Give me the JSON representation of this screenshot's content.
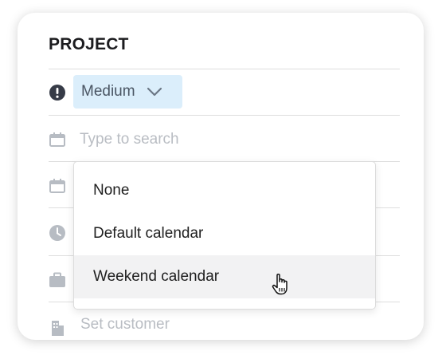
{
  "panel": {
    "title": "PROJECT"
  },
  "priority": {
    "icon": "exclamation-circle-icon",
    "value": "Medium",
    "chevron_icon": "chevron-down-icon",
    "color": "#dbeefb"
  },
  "calendar_search": {
    "icon": "calendar-icon",
    "placeholder": "Type to search",
    "value": ""
  },
  "dropdown": {
    "options": [
      {
        "label": "None",
        "hovered": false
      },
      {
        "label": "Default calendar",
        "hovered": false
      },
      {
        "label": "Weekend calendar",
        "hovered": true
      }
    ]
  },
  "row_icons": {
    "date_icon": "calendar-icon",
    "time_icon": "clock-icon",
    "case_icon": "briefcase-icon",
    "customer_icon": "building-icon"
  },
  "customer": {
    "placeholder": "Set customer"
  },
  "colors": {
    "accent_fill": "#dbeefb",
    "placeholder": "#b9bdc3",
    "icon": "#3a3f4b",
    "icon_muted": "#b7bcc3",
    "hover_row": "#f2f2f3"
  }
}
